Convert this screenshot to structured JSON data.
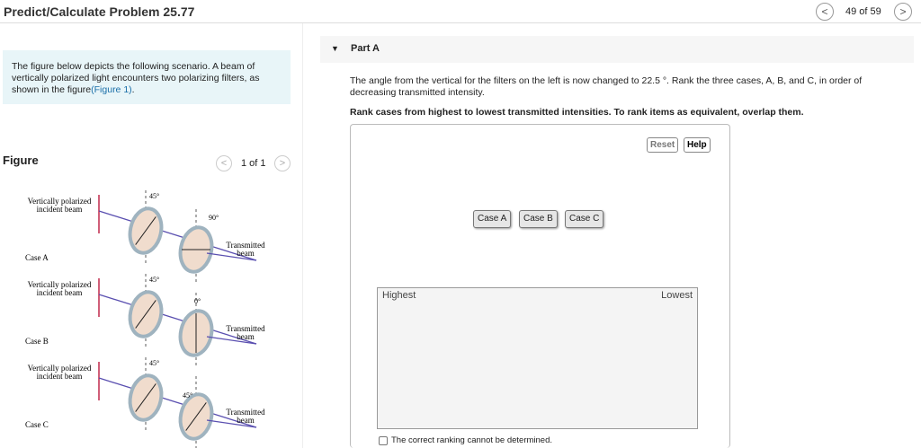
{
  "header": {
    "title": "Predict/Calculate Problem 25.77",
    "pager": "49 of 59",
    "prev_icon": "chevron-left-icon",
    "next_icon": "chevron-right-icon"
  },
  "intro": {
    "text": "The figure below depicts the following scenario. A beam of vertically polarized light encounters two polarizing filters, as shown in the figure",
    "link": "(Figure 1)",
    "end": "."
  },
  "figure": {
    "label": "Figure",
    "pager": "1 of 1",
    "cases": [
      {
        "name": "Case A",
        "incident": [
          "Vertically polarized",
          "incident beam"
        ],
        "angle1": "45°",
        "angle2": "90°",
        "transmitted": [
          "Transmitted",
          "beam"
        ]
      },
      {
        "name": "Case B",
        "incident": [
          "Vertically polarized",
          "incident beam"
        ],
        "angle1": "45°",
        "angle2": "0°",
        "transmitted": [
          "Transmitted",
          "beam"
        ]
      },
      {
        "name": "Case C",
        "incident": [
          "Vertically polarized",
          "incident beam"
        ],
        "angle1": "45°",
        "angle2": "45°",
        "transmitted": [
          "Transmitted",
          "beam"
        ]
      }
    ]
  },
  "part": {
    "label": "Part A",
    "question": "The angle from the vertical for the filters on the left is now changed to 22.5 °. Rank the three cases, A, B, and C, in order of decreasing transmitted intensity.",
    "instruction": "Rank cases from highest to lowest transmitted intensities. To rank items as equivalent, overlap them.",
    "reset": "Reset",
    "help": "Help",
    "items": [
      "Case A",
      "Case B",
      "Case C"
    ],
    "highest": "Highest",
    "lowest": "Lowest",
    "checkbox": "The correct ranking cannot be determined."
  }
}
